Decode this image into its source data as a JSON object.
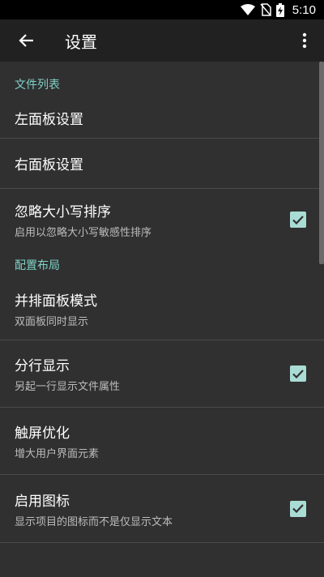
{
  "status_bar": {
    "time": "5:10",
    "icons": [
      "wifi-icon",
      "no-sim-icon",
      "battery-charging-icon"
    ]
  },
  "app_bar": {
    "title": "设置",
    "back_icon": "arrow-left-icon",
    "menu_icon": "more-vert-icon"
  },
  "accent_color": "#7fd1c7",
  "sections": [
    {
      "header": "文件列表",
      "items": [
        {
          "title": "左面板设置"
        },
        {
          "title": "右面板设置"
        },
        {
          "title": "忽略大小写排序",
          "summary": "启用以忽略大小写敏感性排序",
          "checked": true
        }
      ]
    },
    {
      "header": "配置布局",
      "items": [
        {
          "title": "并排面板模式",
          "summary": "双面板同时显示"
        },
        {
          "title": "分行显示",
          "summary": "另起一行显示文件属性",
          "checked": true
        },
        {
          "title": "触屏优化",
          "summary": "增大用户界面元素"
        },
        {
          "title": "启用图标",
          "summary": "显示项目的图标而不是仅显示文本",
          "checked": true
        }
      ]
    }
  ]
}
